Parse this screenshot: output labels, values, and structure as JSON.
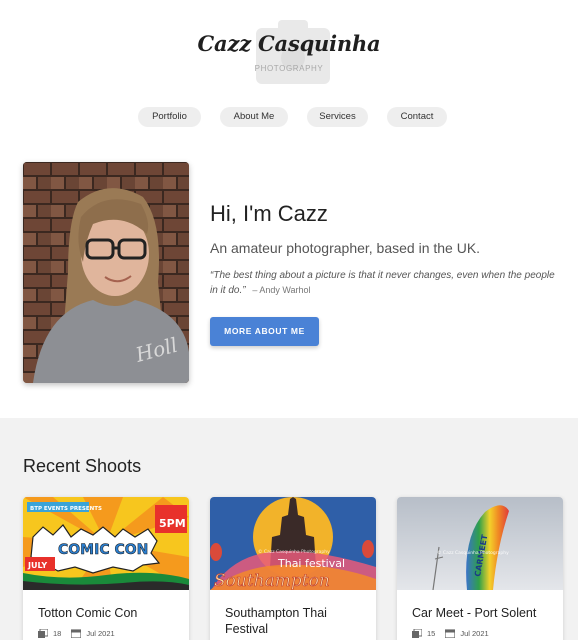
{
  "header": {
    "title": "Cazz Casquinha",
    "subtitle": "PHOTOGRAPHY"
  },
  "nav": {
    "items": [
      {
        "label": "Portfolio"
      },
      {
        "label": "About Me"
      },
      {
        "label": "Services"
      },
      {
        "label": "Contact"
      }
    ]
  },
  "hero": {
    "greeting": "Hi, I'm Cazz",
    "tagline": "An amateur photographer, based in the UK.",
    "quote": "“The best thing about a picture is that it never changes, even when the people in it do.”",
    "quote_author": "– Andy Warhol",
    "button_label": "MORE ABOUT ME"
  },
  "recent": {
    "title": "Recent Shoots",
    "shoots": [
      {
        "title": "Totton Comic Con",
        "photo_count": "18",
        "date": "Jul 2021",
        "image_icon": "comic-con-poster"
      },
      {
        "title": "Southampton Thai Festival",
        "photo_count": "",
        "date": "",
        "image_icon": "thai-festival-poster"
      },
      {
        "title": "Car Meet - Port Solent",
        "photo_count": "15",
        "date": "Jul 2021",
        "image_icon": "feather-flag-photo"
      }
    ],
    "watermark": "© Cazz Casquinha Photography",
    "poster_texts": {
      "comic_con_events": "BTP EVENTS PRESENTS",
      "comic_con_title": "COMIC CON",
      "comic_con_month": "JULY",
      "comic_con_time": "5PM",
      "thai_title": "Thai festival",
      "thai_city": "Southampton",
      "car_flag": "CARMEET"
    }
  },
  "colors": {
    "accent": "#4a82d6",
    "nav_bg": "#eeeeee",
    "section_bg": "#f2f2f2"
  }
}
